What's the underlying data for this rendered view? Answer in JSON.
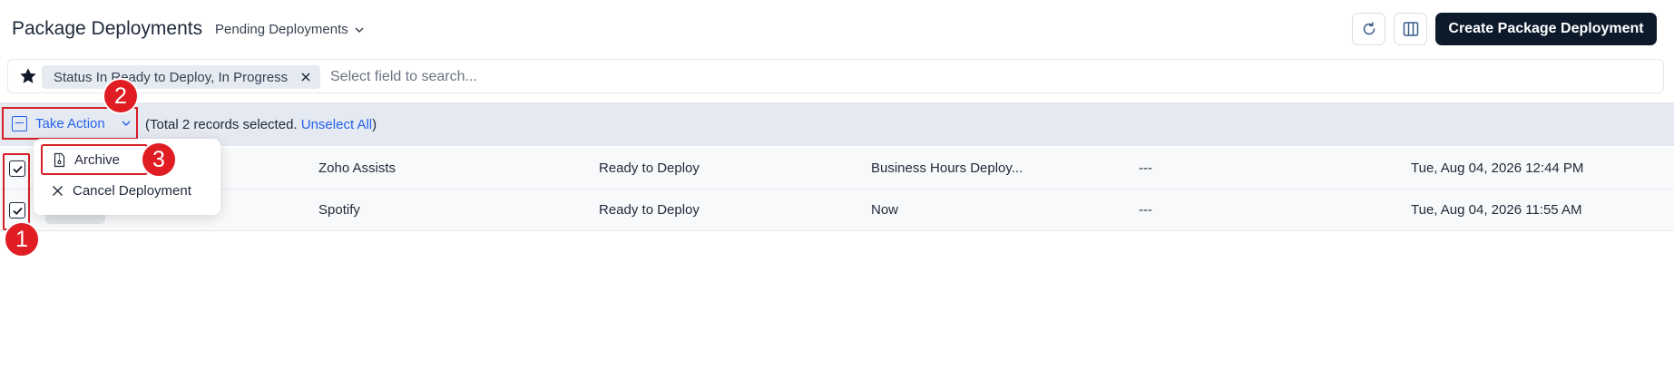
{
  "header": {
    "title": "Package Deployments",
    "view_selector": "Pending Deployments",
    "create_button": "Create Package Deployment",
    "icons": [
      "refresh-icon",
      "columns-icon",
      "chevron-down-icon"
    ]
  },
  "filter": {
    "chip_label": "Status In Ready to Deploy, In Progress",
    "search_placeholder": "Select field to search...",
    "icons": [
      "star-icon",
      "close-icon"
    ]
  },
  "action_bar": {
    "take_action_label": "Take Action",
    "selection_prefix": "(Total 2 records selected. ",
    "unselect_label": "Unselect All",
    "selection_suffix": ")"
  },
  "menu": {
    "items": [
      {
        "label": "Archive",
        "icon": "archive-file-icon"
      },
      {
        "label": "Cancel Deployment",
        "icon": "close-icon"
      }
    ]
  },
  "table": {
    "rows": [
      {
        "checked": true,
        "name": "Zoho Assists",
        "status": "Ready to Deploy",
        "schedule": "Business Hours Deploy...",
        "extra": "---",
        "date": "Tue, Aug 04, 2026 12:44 PM"
      },
      {
        "checked": true,
        "name": "Spotify",
        "status": "Ready to Deploy",
        "schedule": "Now",
        "extra": "---",
        "date": "Tue, Aug 04, 2026 11:55 AM"
      }
    ]
  },
  "annotations": {
    "steps": [
      "1",
      "2",
      "3"
    ],
    "highlight_color": "#d61f26"
  },
  "colors": {
    "primary_button": "#0c1a2b",
    "link": "#2563eb",
    "action_bar_bg": "#e5e9f1",
    "badge": "#e11d24"
  }
}
